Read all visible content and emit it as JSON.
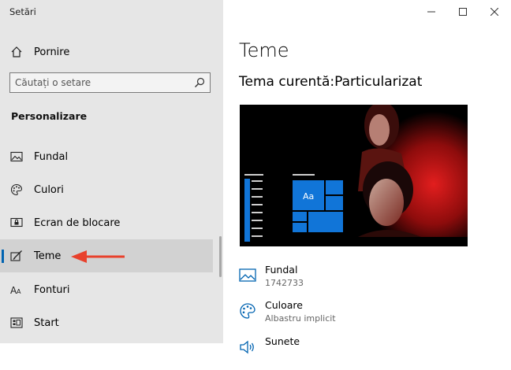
{
  "window": {
    "app_title": "Setări"
  },
  "sidebar": {
    "home_label": "Pornire",
    "search": {
      "placeholder": "Căutați o setare"
    },
    "section_title": "Personalizare",
    "items": [
      {
        "label": "Fundal",
        "icon": "picture-icon"
      },
      {
        "label": "Culori",
        "icon": "palette-icon"
      },
      {
        "label": "Ecran de blocare",
        "icon": "lock-screen-icon"
      },
      {
        "label": "Teme",
        "icon": "brush-icon",
        "selected": true
      },
      {
        "label": "Fonturi",
        "icon": "font-icon"
      },
      {
        "label": "Start",
        "icon": "start-grid-icon"
      }
    ]
  },
  "main": {
    "title": "Teme",
    "current_theme": "Tema curentă:Particularizat",
    "preview": {
      "tile_label": "Aa"
    },
    "settings": [
      {
        "title": "Fundal",
        "subtitle": "1742733",
        "icon": "picture-icon"
      },
      {
        "title": "Culoare",
        "subtitle": "Albastru implicit",
        "icon": "palette-icon"
      },
      {
        "title": "Sunete",
        "subtitle": "",
        "icon": "speaker-icon"
      }
    ]
  },
  "colors": {
    "accent": "#0078d7",
    "sidebar_bg": "#e6e6e6",
    "selected_bg": "#d2d2d2",
    "arrow": "#e8412c"
  }
}
